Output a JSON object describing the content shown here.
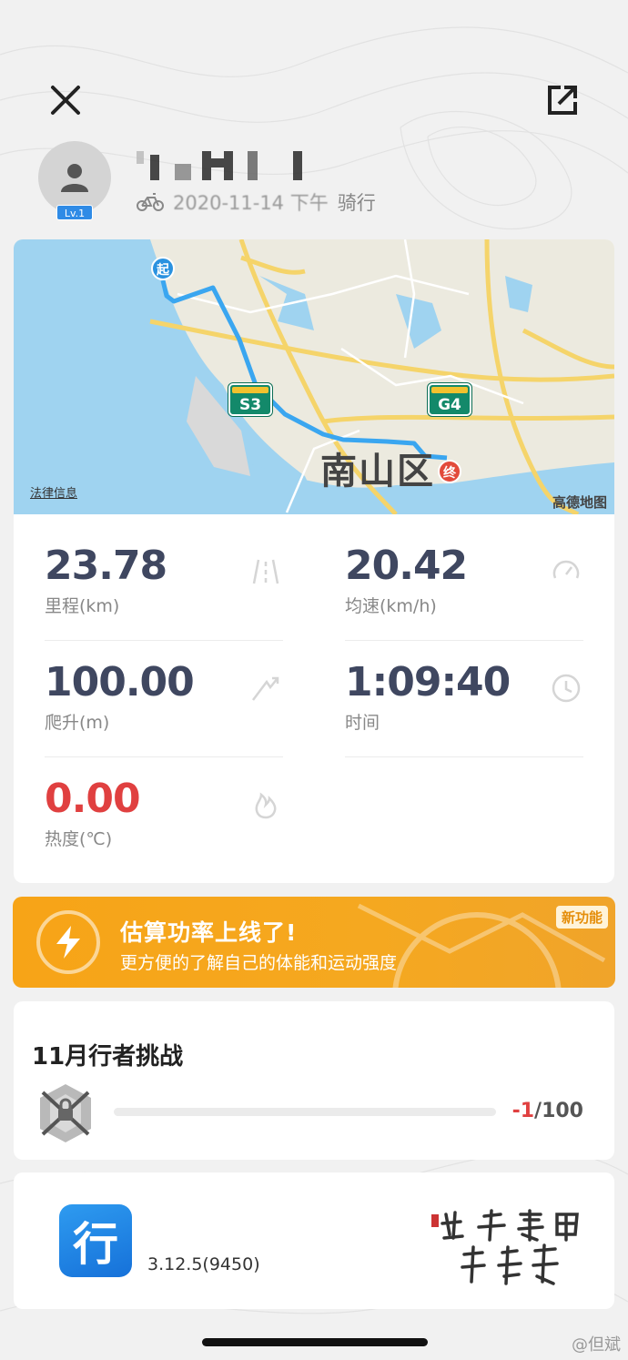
{
  "header": {
    "close_icon": "close-icon",
    "share_icon": "share-icon",
    "level": "Lv.1",
    "date": "2020-11-14 下午",
    "activity_type": "骑行"
  },
  "map": {
    "start_label": "起",
    "end_label": "终",
    "district": "南山区",
    "road_s3": "S3",
    "road_g4": "G4",
    "legal_link": "法律信息",
    "provider": "高德地图"
  },
  "stats": {
    "distance": {
      "value": "23.78",
      "label": "里程(km)",
      "icon": "road-icon"
    },
    "speed": {
      "value": "20.42",
      "label": "均速(km/h)",
      "icon": "speedometer-icon"
    },
    "climb": {
      "value": "100.00",
      "label": "爬升(m)",
      "icon": "climb-icon"
    },
    "time": {
      "value": "1:09:40",
      "label": "时间",
      "icon": "clock-icon"
    },
    "heat": {
      "value": "0.00",
      "label": "热度(℃)",
      "icon": "flame-icon"
    }
  },
  "banner": {
    "title": "估算功率上线了!",
    "subtitle": "更方便的了解自己的体能和运动强度",
    "tag": "新功能"
  },
  "challenge": {
    "title": "11月行者挑战",
    "current": "-1",
    "total": "/100",
    "progress_fraction": 0
  },
  "footer": {
    "app_glyph": "行",
    "version": "3.12.5(9450)"
  },
  "watermark": "@但斌",
  "colors": {
    "accent_blue": "#2f8be6",
    "stat_value": "#3f4760",
    "heat_red": "#e04040",
    "banner_orange": "#f7a417",
    "route_blue": "#3aa6f0"
  }
}
